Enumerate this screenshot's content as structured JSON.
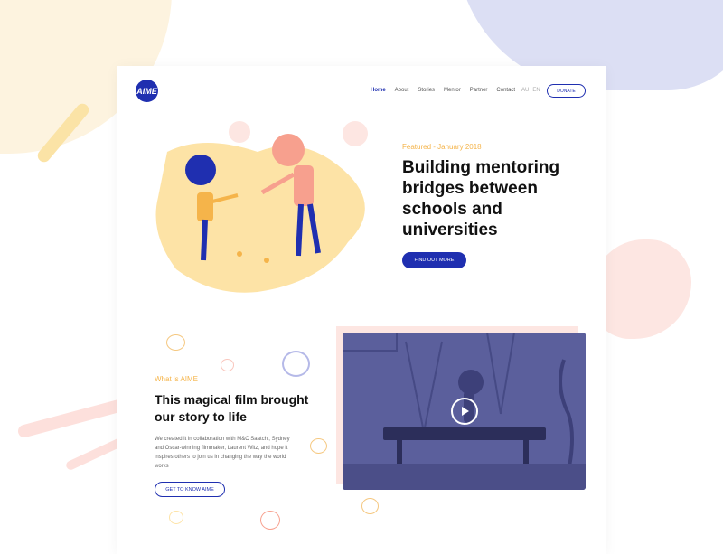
{
  "logo": {
    "text": "AIME"
  },
  "nav": {
    "items": [
      "Home",
      "About",
      "Stories",
      "Mentor",
      "Partner",
      "Contact"
    ],
    "active": "Home"
  },
  "lang": {
    "au": "AU",
    "en": "EN"
  },
  "donate": {
    "label": "DONATE"
  },
  "hero": {
    "featured": "Featured - January 2018",
    "title": "Building mentoring bridges between schools and universities",
    "cta": "FIND OUT MORE"
  },
  "section": {
    "label": "What is AIME",
    "title": "This magical film brought our story to life",
    "body": "We created it in collaboration with M&C Saatchi, Sydney and Oscar-winning filmmaker, Laurent Witz, and hope it inspires others to join us in changing the way the world works",
    "cta": "GET TO KNOW AIME"
  },
  "video": {
    "play_icon": "play-icon"
  },
  "colors": {
    "brand": "#1f2fb0",
    "accent": "#f5b44a",
    "pink": "#fde6e2",
    "lavender": "#dcdff4"
  }
}
